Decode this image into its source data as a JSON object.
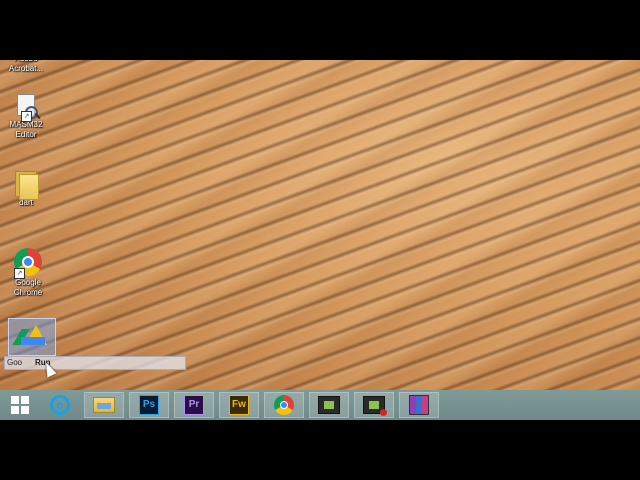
{
  "desktop": {
    "icons": [
      {
        "id": "acrobat",
        "label": "Adobe Acrobat..."
      },
      {
        "id": "masm",
        "label": "MASM32 Editor",
        "label_line1": "MASM32",
        "label_line2": "Editor"
      },
      {
        "id": "dart",
        "label": "dart"
      },
      {
        "id": "chrome",
        "label": "Google Chrome",
        "label_line1": "Google",
        "label_line2": "Chrome"
      }
    ],
    "drag_item": {
      "icon": "google-drive-icon"
    },
    "tooltip": {
      "left_text": "Goo",
      "action": "Run"
    }
  },
  "taskbar": {
    "start_icon": "windows-logo-icon",
    "items": [
      {
        "name": "Internet Explorer",
        "icon": "internet-explorer-icon",
        "glyph": "e"
      },
      {
        "name": "File Explorer",
        "icon": "file-explorer-icon"
      },
      {
        "name": "Photoshop",
        "icon": "photoshop-icon",
        "glyph": "Ps"
      },
      {
        "name": "Premiere",
        "icon": "premiere-icon",
        "glyph": "Pr"
      },
      {
        "name": "Fireworks",
        "icon": "fireworks-icon",
        "glyph": "Fw"
      },
      {
        "name": "Google Chrome",
        "icon": "chrome-icon"
      },
      {
        "name": "Screen app",
        "icon": "screen-app-icon"
      },
      {
        "name": "Screen recorder",
        "icon": "screen-recorder-icon"
      },
      {
        "name": "WinRAR",
        "icon": "winrar-icon"
      }
    ]
  },
  "colors": {
    "taskbar": "#7a9594",
    "sand": "#d59a5f",
    "tooltip_bg": "#e1e6f0"
  }
}
